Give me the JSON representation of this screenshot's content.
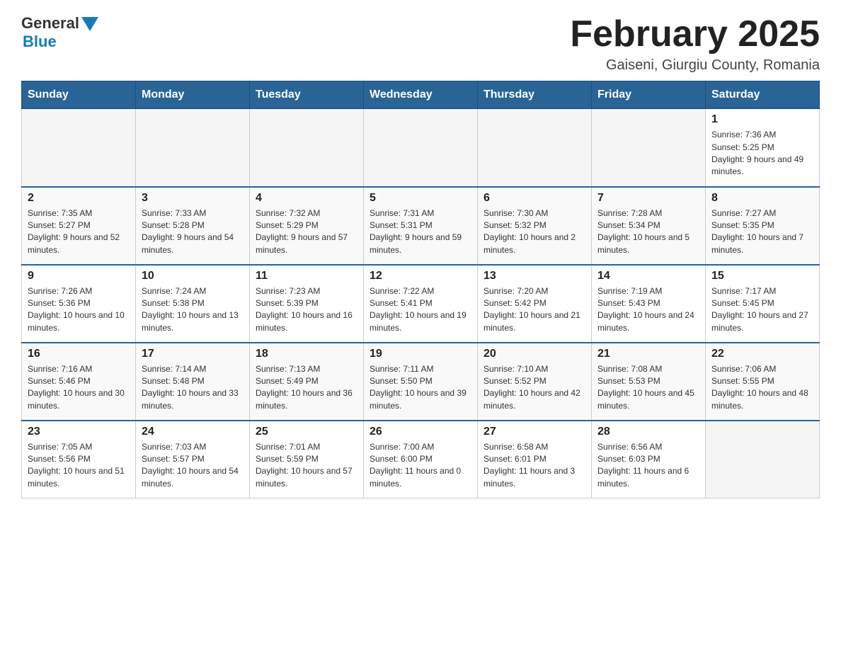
{
  "logo": {
    "general": "General",
    "blue": "Blue"
  },
  "title": "February 2025",
  "subtitle": "Gaiseni, Giurgiu County, Romania",
  "headers": [
    "Sunday",
    "Monday",
    "Tuesday",
    "Wednesday",
    "Thursday",
    "Friday",
    "Saturday"
  ],
  "weeks": [
    [
      {
        "day": "",
        "info": ""
      },
      {
        "day": "",
        "info": ""
      },
      {
        "day": "",
        "info": ""
      },
      {
        "day": "",
        "info": ""
      },
      {
        "day": "",
        "info": ""
      },
      {
        "day": "",
        "info": ""
      },
      {
        "day": "1",
        "info": "Sunrise: 7:36 AM\nSunset: 5:25 PM\nDaylight: 9 hours and 49 minutes."
      }
    ],
    [
      {
        "day": "2",
        "info": "Sunrise: 7:35 AM\nSunset: 5:27 PM\nDaylight: 9 hours and 52 minutes."
      },
      {
        "day": "3",
        "info": "Sunrise: 7:33 AM\nSunset: 5:28 PM\nDaylight: 9 hours and 54 minutes."
      },
      {
        "day": "4",
        "info": "Sunrise: 7:32 AM\nSunset: 5:29 PM\nDaylight: 9 hours and 57 minutes."
      },
      {
        "day": "5",
        "info": "Sunrise: 7:31 AM\nSunset: 5:31 PM\nDaylight: 9 hours and 59 minutes."
      },
      {
        "day": "6",
        "info": "Sunrise: 7:30 AM\nSunset: 5:32 PM\nDaylight: 10 hours and 2 minutes."
      },
      {
        "day": "7",
        "info": "Sunrise: 7:28 AM\nSunset: 5:34 PM\nDaylight: 10 hours and 5 minutes."
      },
      {
        "day": "8",
        "info": "Sunrise: 7:27 AM\nSunset: 5:35 PM\nDaylight: 10 hours and 7 minutes."
      }
    ],
    [
      {
        "day": "9",
        "info": "Sunrise: 7:26 AM\nSunset: 5:36 PM\nDaylight: 10 hours and 10 minutes."
      },
      {
        "day": "10",
        "info": "Sunrise: 7:24 AM\nSunset: 5:38 PM\nDaylight: 10 hours and 13 minutes."
      },
      {
        "day": "11",
        "info": "Sunrise: 7:23 AM\nSunset: 5:39 PM\nDaylight: 10 hours and 16 minutes."
      },
      {
        "day": "12",
        "info": "Sunrise: 7:22 AM\nSunset: 5:41 PM\nDaylight: 10 hours and 19 minutes."
      },
      {
        "day": "13",
        "info": "Sunrise: 7:20 AM\nSunset: 5:42 PM\nDaylight: 10 hours and 21 minutes."
      },
      {
        "day": "14",
        "info": "Sunrise: 7:19 AM\nSunset: 5:43 PM\nDaylight: 10 hours and 24 minutes."
      },
      {
        "day": "15",
        "info": "Sunrise: 7:17 AM\nSunset: 5:45 PM\nDaylight: 10 hours and 27 minutes."
      }
    ],
    [
      {
        "day": "16",
        "info": "Sunrise: 7:16 AM\nSunset: 5:46 PM\nDaylight: 10 hours and 30 minutes."
      },
      {
        "day": "17",
        "info": "Sunrise: 7:14 AM\nSunset: 5:48 PM\nDaylight: 10 hours and 33 minutes."
      },
      {
        "day": "18",
        "info": "Sunrise: 7:13 AM\nSunset: 5:49 PM\nDaylight: 10 hours and 36 minutes."
      },
      {
        "day": "19",
        "info": "Sunrise: 7:11 AM\nSunset: 5:50 PM\nDaylight: 10 hours and 39 minutes."
      },
      {
        "day": "20",
        "info": "Sunrise: 7:10 AM\nSunset: 5:52 PM\nDaylight: 10 hours and 42 minutes."
      },
      {
        "day": "21",
        "info": "Sunrise: 7:08 AM\nSunset: 5:53 PM\nDaylight: 10 hours and 45 minutes."
      },
      {
        "day": "22",
        "info": "Sunrise: 7:06 AM\nSunset: 5:55 PM\nDaylight: 10 hours and 48 minutes."
      }
    ],
    [
      {
        "day": "23",
        "info": "Sunrise: 7:05 AM\nSunset: 5:56 PM\nDaylight: 10 hours and 51 minutes."
      },
      {
        "day": "24",
        "info": "Sunrise: 7:03 AM\nSunset: 5:57 PM\nDaylight: 10 hours and 54 minutes."
      },
      {
        "day": "25",
        "info": "Sunrise: 7:01 AM\nSunset: 5:59 PM\nDaylight: 10 hours and 57 minutes."
      },
      {
        "day": "26",
        "info": "Sunrise: 7:00 AM\nSunset: 6:00 PM\nDaylight: 11 hours and 0 minutes."
      },
      {
        "day": "27",
        "info": "Sunrise: 6:58 AM\nSunset: 6:01 PM\nDaylight: 11 hours and 3 minutes."
      },
      {
        "day": "28",
        "info": "Sunrise: 6:56 AM\nSunset: 6:03 PM\nDaylight: 11 hours and 6 minutes."
      },
      {
        "day": "",
        "info": ""
      }
    ]
  ]
}
